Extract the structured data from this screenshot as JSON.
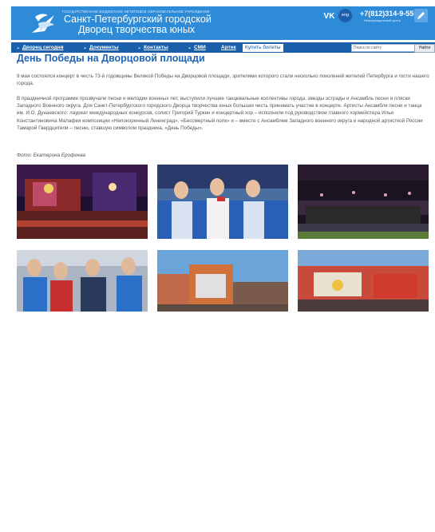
{
  "header": {
    "org_small": "ГОСУДАРСТВЕННОЕ БЮДЖЕТНОЕ НЕТИПОВОЕ ОБРАЗОВАТЕЛЬНОЕ УЧРЕЖДЕНИЕ",
    "org_line1": "Санкт-Петербургский городской",
    "org_line2": "Дворец творчества юных",
    "vk_label": "VK",
    "eng_label": "eng",
    "phone": "+7(812)314-9-555",
    "info_label": "Информационный центр",
    "icons": {
      "logo": "dove-logo",
      "vk": "vk-icon",
      "edit": "edit-icon"
    }
  },
  "nav": {
    "items": [
      {
        "label": "Дворец сегодня",
        "chevron": true
      },
      {
        "label": "Документы",
        "chevron": true
      },
      {
        "label": "Контакты",
        "chevron": true
      },
      {
        "label": "СМИ",
        "chevron": true
      },
      {
        "label": "Артек",
        "chevron": false
      }
    ],
    "tickets_button": "Купить билеты",
    "search_placeholder": "Поиск по сайту",
    "search_button": "Найти"
  },
  "article": {
    "title": "День Победы на Дворцовой площади",
    "paragraph1": "9 мая состоялся концерт в честь 73-й годовщины Великой Победы на Дворцовой площади, зрителями которого стали несколько поколений жителей Петербурга и гости нашего города.",
    "paragraph2": "В праздничной программе прозвучали песни и мелодии военных лет, выступили лучшие танцевальные коллективы города, звезды эстрады и Ансамбль песни и пляски Западного Военного округа. Для Санкт-Петербургского городского Дворца творчества юных большая честь принимать участие в концерте. Артисты Ансамбля песни и танца им. И.О. Дунаевского: лауреат международных конкурсов, солист Григорий Туркин и концертный хор – исполнили под руководством главного хормейстера Ильи Константиновича Малафея композиции «Непокоренный Ленинград», «Бессмертный полк» и – вместе с Ансамблем Западного военного округа и народной артисткой России Тамарой Гвердцители – песню, ставшую символом праздника, «День Победы».",
    "photo_credit": "Фото: Екатерина Ерофеева"
  },
  "colors": {
    "header_bg": "#2e8bd8",
    "nav_bg": "#1a5fa9",
    "title": "#1c63b7"
  }
}
